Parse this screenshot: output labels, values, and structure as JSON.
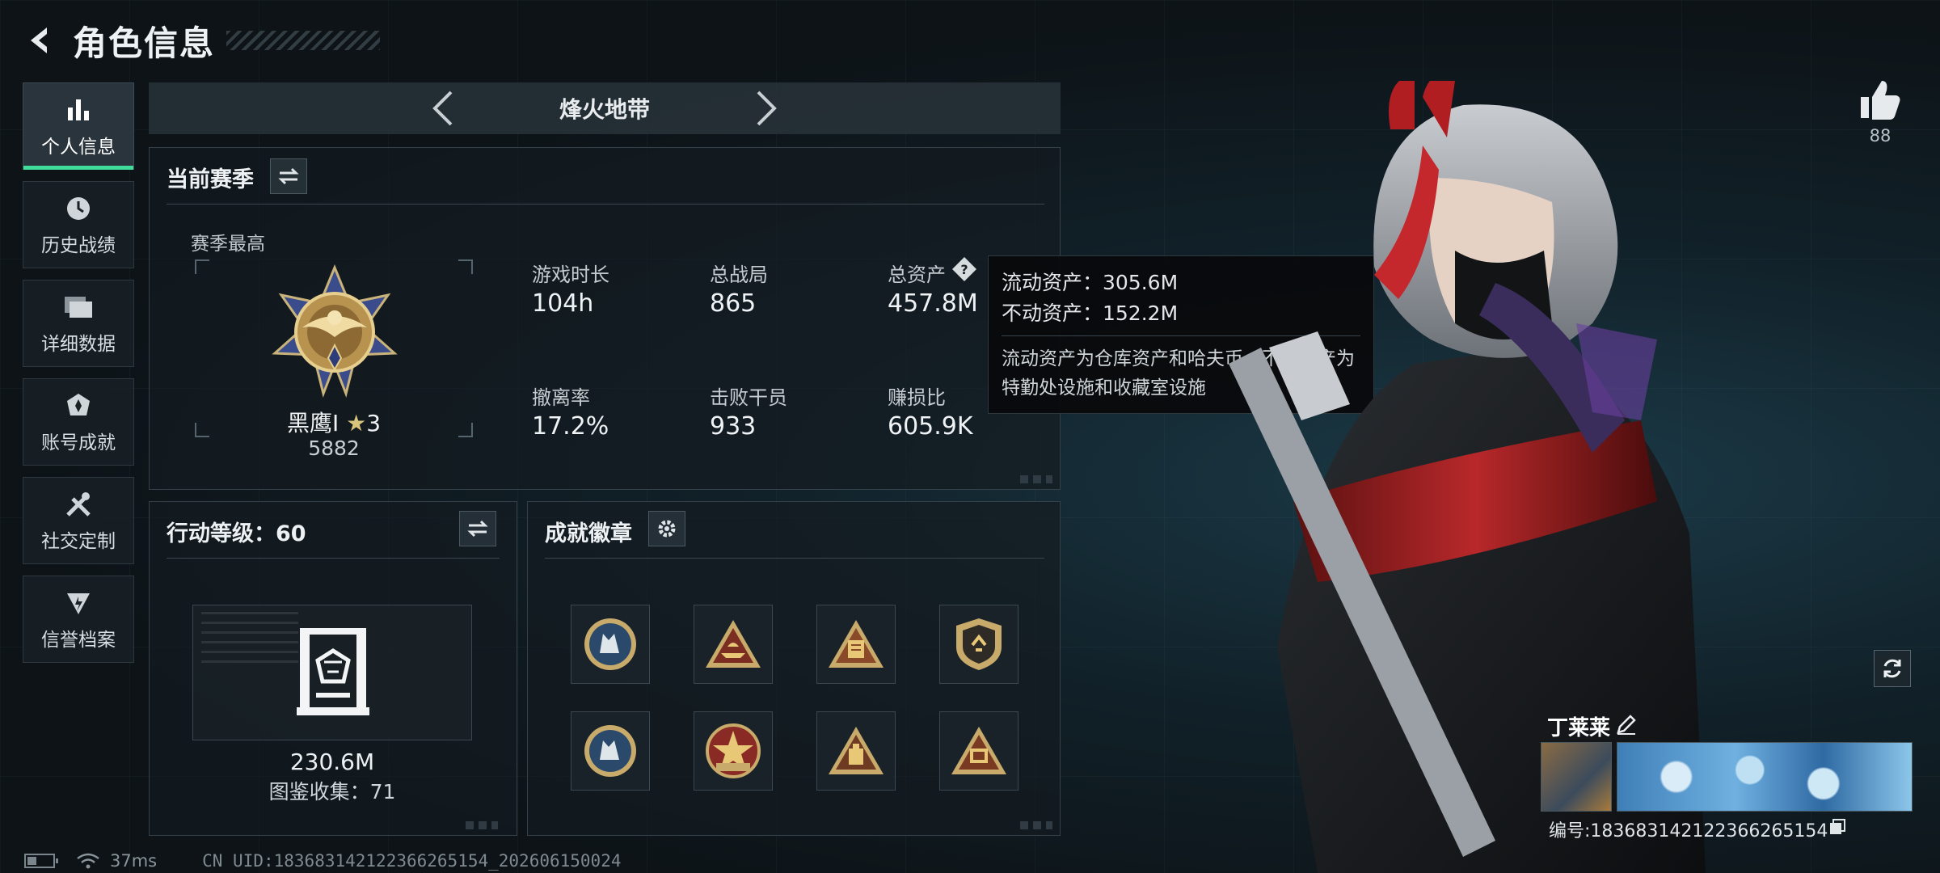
{
  "header": {
    "title": "角色信息"
  },
  "nav": {
    "items": [
      {
        "label": "个人信息",
        "icon": "bar-chart-icon",
        "active": true
      },
      {
        "label": "历史战绩",
        "icon": "clock-icon"
      },
      {
        "label": "详细数据",
        "icon": "folder-icon"
      },
      {
        "label": "账号成就",
        "icon": "achievement-icon"
      },
      {
        "label": "社交定制",
        "icon": "tools-icon"
      },
      {
        "label": "信誉档案",
        "icon": "shield-bolt-icon"
      }
    ]
  },
  "mode": {
    "label": "烽火地带"
  },
  "season": {
    "title": "当前赛季",
    "best_label": "赛季最高",
    "rank_name": "黑鹰I",
    "rank_stars": "3",
    "rank_score": "5882",
    "stats": [
      {
        "label": "游戏时长",
        "value": "104h"
      },
      {
        "label": "总战局",
        "value": "865"
      },
      {
        "label": "总资产",
        "value": "457.8M"
      },
      {
        "label": "撤离率",
        "value": "17.2%"
      },
      {
        "label": "击败干员",
        "value": "933"
      },
      {
        "label": "赚损比",
        "value": "605.9K"
      }
    ]
  },
  "tooltip": {
    "liquid": "流动资产：305.6M",
    "fixed": "不动资产：152.2M",
    "desc": "流动资产为仓库资产和哈夫币，不动资产为特勤处设施和收藏室设施"
  },
  "level": {
    "title": "行动等级：60",
    "asset_value": "230.6M",
    "collection": "图鉴收集：71"
  },
  "badges": {
    "title": "成就徽章",
    "items": [
      "wolf-badge",
      "ship-badge",
      "book-badge",
      "shield-badge",
      "wolf-badge",
      "star-badge",
      "device-badge",
      "number-badge"
    ]
  },
  "profile": {
    "likes": "88",
    "player_name": "丁莱莱",
    "card_id": "编号:183683142122366265154"
  },
  "status": {
    "ping": "37ms",
    "uid": "CN UID:183683142122366265154_202606150024",
    "battery_level": 0.35
  },
  "colors": {
    "accent": "#3fdc9a",
    "panel_border": "#34414a",
    "background": "#0f1418"
  }
}
